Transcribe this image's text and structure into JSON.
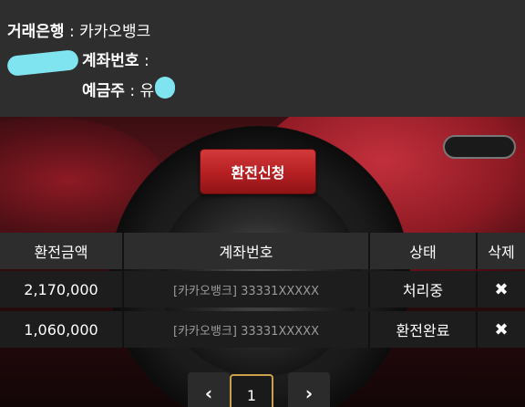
{
  "account_info": {
    "bank_label": "거래은행",
    "bank_value": "카카오뱅크",
    "account_label": "계좌번호",
    "account_value": "",
    "owner_label": "예금주",
    "owner_value": "유 준",
    "separator": " : "
  },
  "actions": {
    "apply_label": "환전신청"
  },
  "table": {
    "headers": [
      "환전금액",
      "계좌번호",
      "상태",
      "삭제"
    ],
    "rows": [
      {
        "amount": "2,170,000",
        "account": "[카카오뱅크] 33331XXXXX",
        "status": "처리중",
        "delete": "✖"
      },
      {
        "amount": "1,060,000",
        "account": "[카카오뱅크] 33331XXXXX",
        "status": "환전완료",
        "delete": "✖"
      }
    ]
  },
  "pagination": {
    "prev": "‹",
    "current": "1",
    "next": "›"
  },
  "colors": {
    "button_red": "#b51f22",
    "pager_active_border": "#c9a14a",
    "redaction": "#7fe3f0"
  }
}
